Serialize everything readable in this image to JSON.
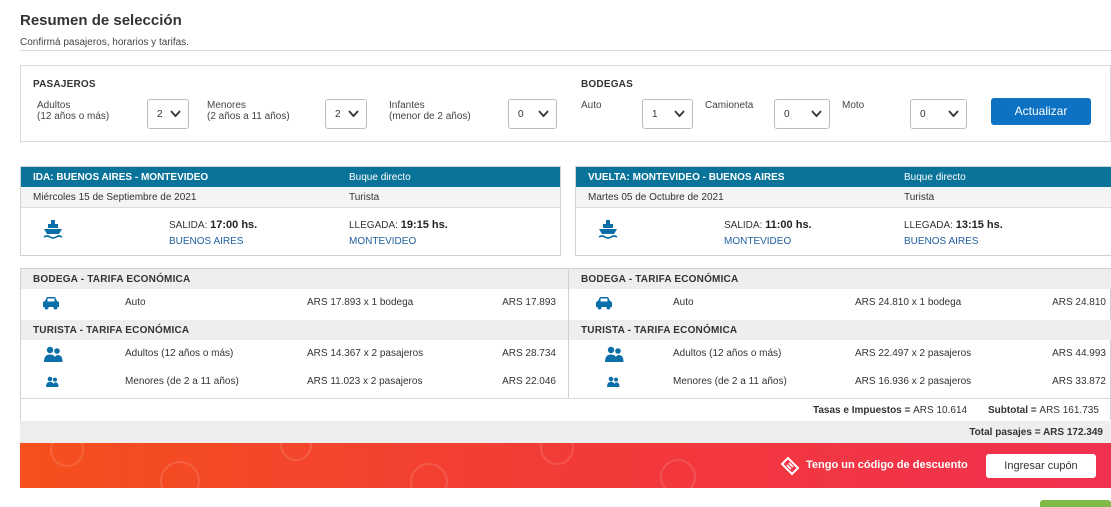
{
  "header": {
    "title": "Resumen de selección",
    "subtitle": "Confirmá pasajeros, horarios y tarifas."
  },
  "passengers": {
    "section_label": "PASAJEROS",
    "adults": {
      "label_line1": "Adultos",
      "label_line2": "(12 años o más)",
      "value": "2"
    },
    "minors": {
      "label_line1": "Menores",
      "label_line2": "(2 años a 11 años)",
      "value": "2"
    },
    "infants": {
      "label_line1": "Infantes",
      "label_line2": "(menor de 2 años)",
      "value": "0"
    }
  },
  "holds": {
    "section_label": "BODEGAS",
    "car": {
      "label": "Auto",
      "value": "1"
    },
    "van": {
      "label": "Camioneta",
      "value": "0"
    },
    "moto": {
      "label": "Moto",
      "value": "0"
    }
  },
  "update_button": "Actualizar",
  "outbound": {
    "route": "IDA: BUENOS AIRES - MONTEVIDEO",
    "ship_type": "Buque directo",
    "date": "Miércoles 15 de Septiembre de 2021",
    "class": "Turista",
    "departure_label": "SALIDA:",
    "departure_time": "17:00 hs.",
    "departure_city": "BUENOS AIRES",
    "arrival_label": "LLEGADA:",
    "arrival_time": "19:15 hs.",
    "arrival_city": "MONTEVIDEO"
  },
  "return": {
    "route": "VUELTA: MONTEVIDEO - BUENOS AIRES",
    "ship_type": "Buque directo",
    "date": "Martes 05 de Octubre de 2021",
    "class": "Turista",
    "departure_label": "SALIDA:",
    "departure_time": "11:00 hs.",
    "departure_city": "MONTEVIDEO",
    "arrival_label": "LLEGADA:",
    "arrival_time": "13:15 hs.",
    "arrival_city": "BUENOS AIRES"
  },
  "pricing": {
    "outbound": {
      "hold_header": "BODEGA - TARIFA ECONÓMICA",
      "hold_rows": [
        {
          "icon": "car-icon",
          "name": "Auto",
          "unit": "ARS 17.893 x 1 bodega",
          "total": "ARS 17.893"
        }
      ],
      "tourist_header": "TURISTA - TARIFA ECONÓMICA",
      "tourist_rows": [
        {
          "icon": "adults-icon",
          "name": "Adultos (12 años o más)",
          "unit": "ARS 14.367 x 2 pasajeros",
          "total": "ARS 28.734"
        },
        {
          "icon": "minors-icon",
          "name": "Menores (de 2 a 11 años)",
          "unit": "ARS 11.023 x 2 pasajeros",
          "total": "ARS 22.046"
        }
      ]
    },
    "return": {
      "hold_header": "BODEGA - TARIFA ECONÓMICA",
      "hold_rows": [
        {
          "icon": "car-icon",
          "name": "Auto",
          "unit": "ARS 24.810 x 1 bodega",
          "total": "ARS 24.810"
        }
      ],
      "tourist_header": "TURISTA - TARIFA ECONÓMICA",
      "tourist_rows": [
        {
          "icon": "adults-icon",
          "name": "Adultos (12 años o más)",
          "unit": "ARS 22.497 x 2 pasajeros",
          "total": "ARS 44.993"
        },
        {
          "icon": "minors-icon",
          "name": "Menores (de 2 a 11 años)",
          "unit": "ARS 16.936 x 2 pasajeros",
          "total": "ARS 33.872"
        }
      ]
    },
    "taxes_label": "Tasas e Impuestos =",
    "taxes_value": "ARS 10.614",
    "subtotal_label": "Subtotal =",
    "subtotal_value": "ARS 161.735",
    "total_label": "Total pasajes = ARS 172.349"
  },
  "promo": {
    "text": "Tengo un código de descuento",
    "button": "Ingresar cupón",
    "icon": "coupon-tag-icon"
  },
  "colors": {
    "primary_button": "#0d72c3",
    "trip_header": "#0a739a",
    "promo_gradient_start": "#f5501d",
    "promo_gradient_end": "#f03150",
    "icon_blue": "#0a6fa8"
  }
}
